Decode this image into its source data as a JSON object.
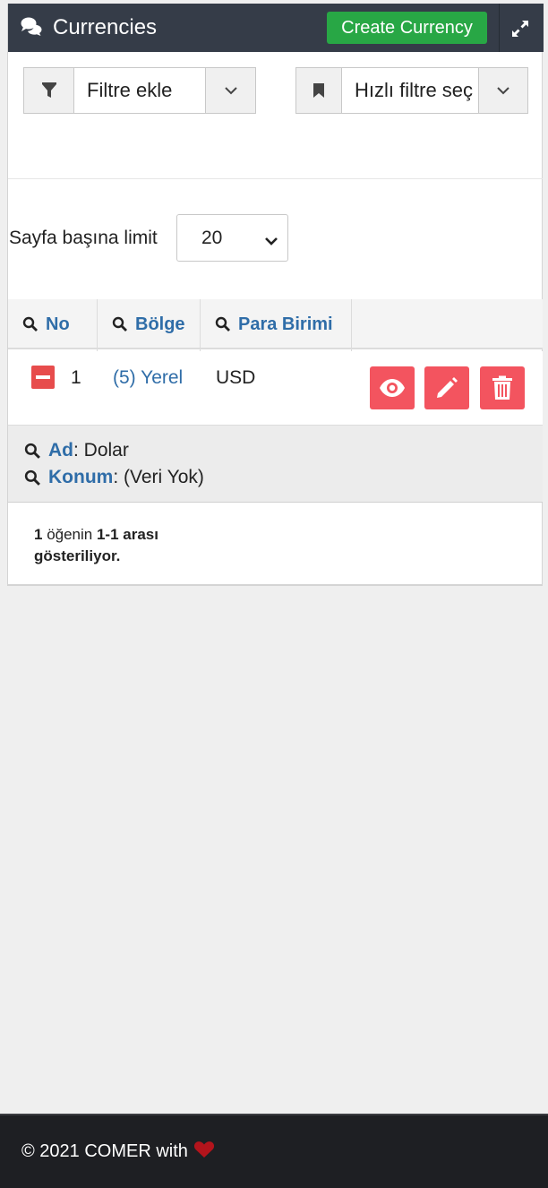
{
  "header": {
    "title": "Currencies",
    "title_icon": "comments-icon",
    "create_label": "Create Currency",
    "expand_icon": "expand-icon"
  },
  "filters": {
    "add_filter_placeholder": "Filtre ekle",
    "quick_filter_placeholder": "Hızlı filtre seç"
  },
  "pagination": {
    "limit_label": "Sayfa başına limit",
    "limit_value": "20"
  },
  "table": {
    "columns": [
      "No",
      "Bölge",
      "Para Birimi"
    ],
    "rows": [
      {
        "no": "1",
        "region": "(5) Yerel",
        "currency": "USD"
      }
    ],
    "detail": {
      "name_key": "Ad",
      "name_value": ": Dolar",
      "location_key": "Konum",
      "location_value": ": (Veri Yok)"
    }
  },
  "summary": {
    "count": "1",
    "mid": " öğenin ",
    "range": "1-1 arası",
    "tail": "gösteriliyor."
  },
  "footer": {
    "text": "© 2021 COMER with"
  },
  "colors": {
    "header_bg": "#353c48",
    "create_button": "#28a745",
    "link_blue": "#2f6da8",
    "action_red": "#f3545f",
    "heart": "#b3141c"
  }
}
